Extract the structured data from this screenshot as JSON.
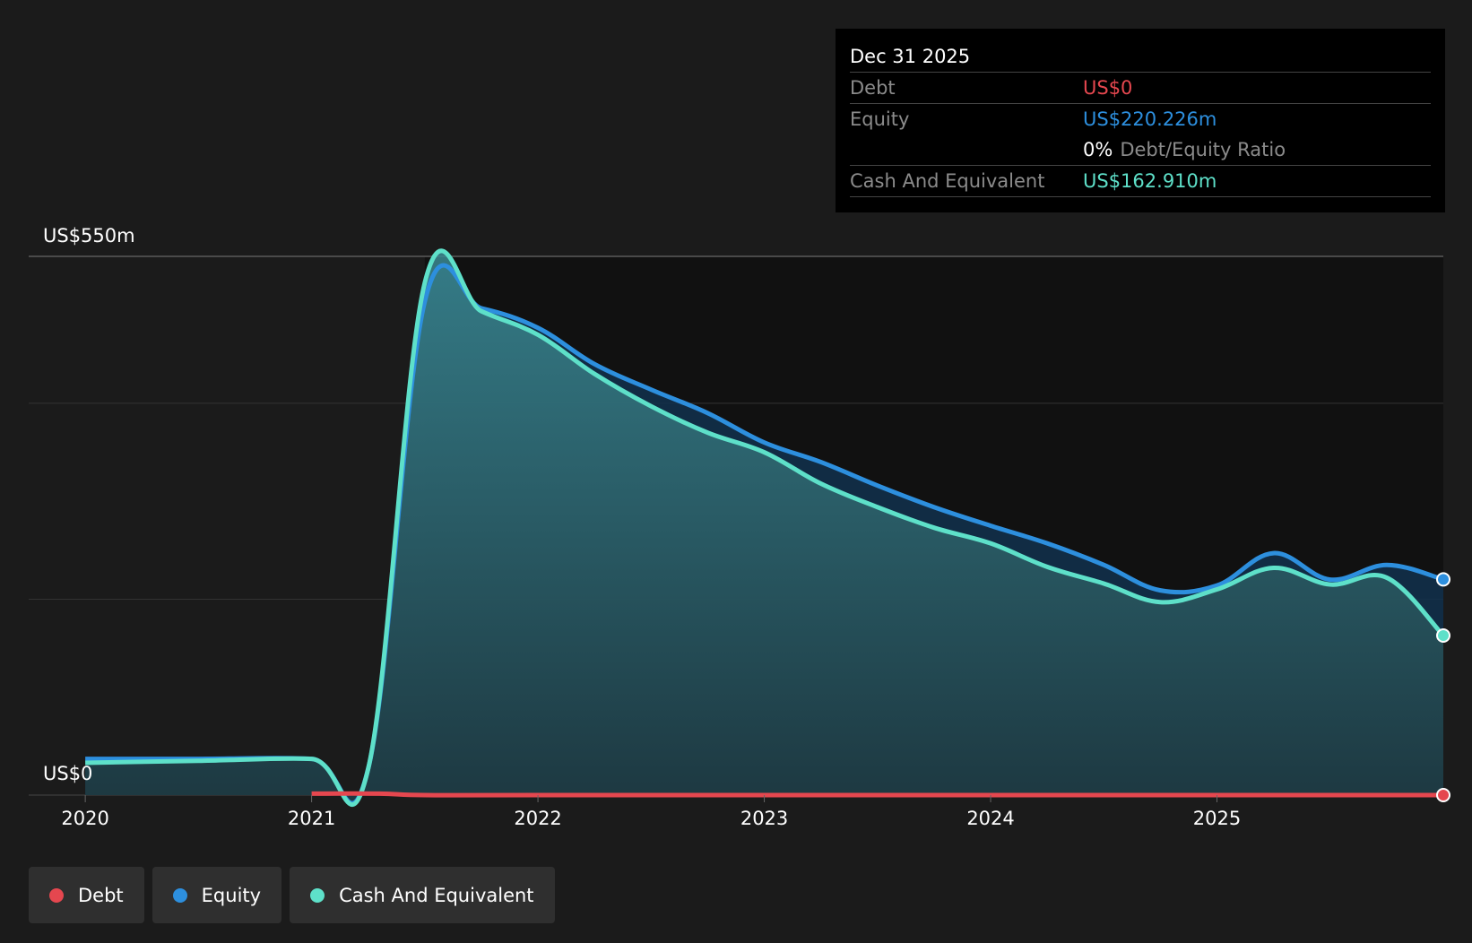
{
  "tooltip": {
    "date": "Dec 31 2025",
    "debt_label": "Debt",
    "debt_value": "US$0",
    "equity_label": "Equity",
    "equity_value": "US$220.226m",
    "ratio_value": "0%",
    "ratio_label": "Debt/Equity Ratio",
    "cash_label": "Cash And Equivalent",
    "cash_value": "US$162.910m"
  },
  "legend": [
    {
      "label": "Debt",
      "color": "#e5474f"
    },
    {
      "label": "Equity",
      "color": "#2d8fde"
    },
    {
      "label": "Cash And Equivalent",
      "color": "#5ee0c9"
    }
  ],
  "colors": {
    "debt": "#e5474f",
    "equity": "#2d8fde",
    "cash": "#5ee0c9",
    "background": "#1b1b1b"
  },
  "chart_data": {
    "type": "area",
    "y_top_label": "US$550m",
    "y_bottom_label": "US$0",
    "ylim": [
      0,
      550
    ],
    "xlim": [
      2019.75,
      2026.0
    ],
    "x_ticks": [
      2020,
      2021,
      2022,
      2023,
      2024,
      2025
    ],
    "x_tick_labels": [
      "2020",
      "2021",
      "2022",
      "2023",
      "2024",
      "2025"
    ],
    "grid": true,
    "highlight_from_x": 2021.5,
    "series": [
      {
        "name": "Debt",
        "points": [
          [
            2021.0,
            1.5
          ],
          [
            2021.3,
            1.5
          ],
          [
            2021.5,
            0
          ],
          [
            2022.0,
            0
          ],
          [
            2023.0,
            0
          ],
          [
            2024.0,
            0
          ],
          [
            2025.0,
            0
          ],
          [
            2026.0,
            0
          ]
        ]
      },
      {
        "name": "Equity",
        "points": [
          [
            2020.0,
            37
          ],
          [
            2020.5,
            37
          ],
          [
            2021.0,
            37
          ],
          [
            2021.25,
            27
          ],
          [
            2021.5,
            504
          ],
          [
            2021.75,
            497
          ],
          [
            2022.0,
            477
          ],
          [
            2022.25,
            440
          ],
          [
            2022.5,
            414
          ],
          [
            2022.75,
            390
          ],
          [
            2023.0,
            360
          ],
          [
            2023.25,
            340
          ],
          [
            2023.5,
            316
          ],
          [
            2023.75,
            294
          ],
          [
            2024.0,
            275
          ],
          [
            2024.25,
            257
          ],
          [
            2024.5,
            235
          ],
          [
            2024.75,
            209
          ],
          [
            2025.0,
            214
          ],
          [
            2025.25,
            247
          ],
          [
            2025.5,
            220
          ],
          [
            2025.75,
            235
          ],
          [
            2026.0,
            220.226
          ]
        ]
      },
      {
        "name": "Cash And Equivalent",
        "points": [
          [
            2020.0,
            33
          ],
          [
            2020.5,
            35
          ],
          [
            2021.0,
            37
          ],
          [
            2021.25,
            27
          ],
          [
            2021.5,
            523
          ],
          [
            2021.75,
            494
          ],
          [
            2022.0,
            470
          ],
          [
            2022.25,
            430
          ],
          [
            2022.5,
            397
          ],
          [
            2022.75,
            370
          ],
          [
            2023.0,
            350
          ],
          [
            2023.25,
            318
          ],
          [
            2023.5,
            294
          ],
          [
            2023.75,
            273
          ],
          [
            2024.0,
            257
          ],
          [
            2024.25,
            233
          ],
          [
            2024.5,
            216
          ],
          [
            2024.75,
            197
          ],
          [
            2025.0,
            210
          ],
          [
            2025.25,
            232
          ],
          [
            2025.5,
            215
          ],
          [
            2025.75,
            222
          ],
          [
            2026.0,
            162.91
          ]
        ]
      }
    ]
  }
}
